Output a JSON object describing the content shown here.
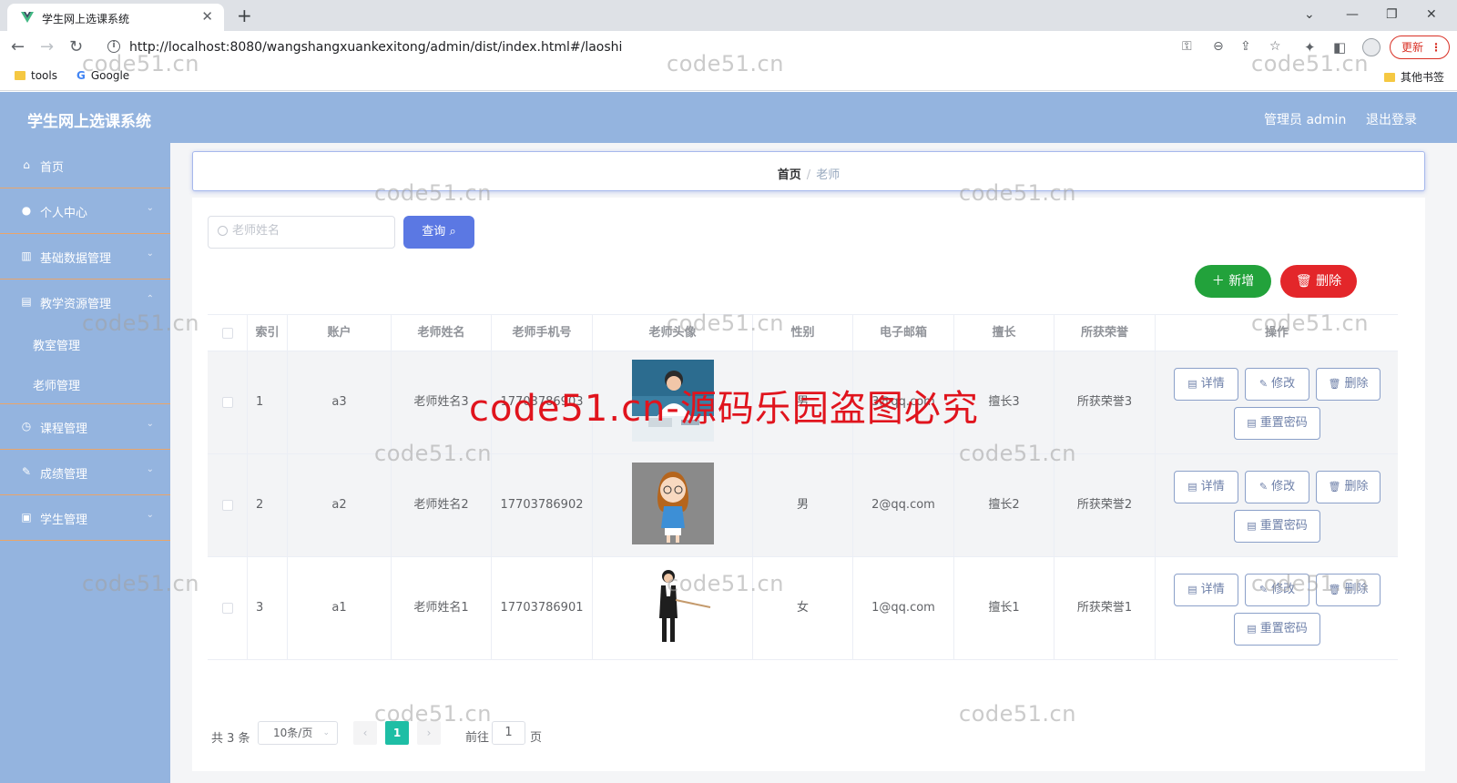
{
  "browser": {
    "tab_title": "学生网上选课系统",
    "url": "http://localhost:8080/wangshangxuankexitong/admin/dist/index.html#/laoshi",
    "update_label": "更新",
    "bookmarks": [
      "tools",
      "Google"
    ],
    "other_bookmarks": "其他书签"
  },
  "header": {
    "brand": "学生网上选课系统",
    "user": "管理员 admin",
    "logout": "退出登录"
  },
  "sidebar": {
    "items": [
      {
        "label": "首页",
        "icon": "home-icon"
      },
      {
        "label": "个人中心",
        "icon": "user-icon"
      },
      {
        "label": "基础数据管理",
        "icon": "data-icon"
      },
      {
        "label": "教学资源管理",
        "icon": "resource-icon"
      },
      {
        "label": "课程管理",
        "icon": "course-icon"
      },
      {
        "label": "成绩管理",
        "icon": "grade-icon"
      },
      {
        "label": "学生管理",
        "icon": "student-icon"
      }
    ],
    "sub_items": [
      "教室管理",
      "老师管理"
    ]
  },
  "breadcrumb": {
    "home": "首页",
    "separator": "/",
    "current": "老师"
  },
  "search": {
    "placeholder": "老师姓名",
    "button": "查询"
  },
  "actions": {
    "add": "新增",
    "delete": "删除"
  },
  "table": {
    "headers": [
      "索引",
      "账户",
      "老师姓名",
      "老师手机号",
      "老师头像",
      "性别",
      "电子邮箱",
      "擅长",
      "所获荣誉",
      "操作"
    ],
    "rows": [
      {
        "index": "1",
        "account": "a3",
        "name": "老师姓名3",
        "phone": "17703786903",
        "gender": "男",
        "email": "3@qq.com",
        "specialty": "擅长3",
        "honor": "所获荣誉3"
      },
      {
        "index": "2",
        "account": "a2",
        "name": "老师姓名2",
        "phone": "17703786902",
        "gender": "男",
        "email": "2@qq.com",
        "specialty": "擅长2",
        "honor": "所获荣誉2"
      },
      {
        "index": "3",
        "account": "a1",
        "name": "老师姓名1",
        "phone": "17703786901",
        "gender": "女",
        "email": "1@qq.com",
        "specialty": "擅长1",
        "honor": "所获荣誉1"
      }
    ],
    "row_buttons": {
      "detail": "详情",
      "edit": "修改",
      "delete": "删除",
      "reset": "重置密码"
    }
  },
  "pagination": {
    "total": "共 3 条",
    "page_size": "10条/页",
    "current": "1",
    "goto": "前往",
    "goto_value": "1",
    "unit": "页"
  },
  "watermark": {
    "small": "code51.cn",
    "big": "code51.cn-源码乐园盗图必究"
  },
  "colors": {
    "header": "#94b4df",
    "primary": "#5b78e3",
    "success": "#22a23b",
    "danger": "#e3262a",
    "page_active": "#1ebea5",
    "menu_divider": "#e9a56a"
  }
}
